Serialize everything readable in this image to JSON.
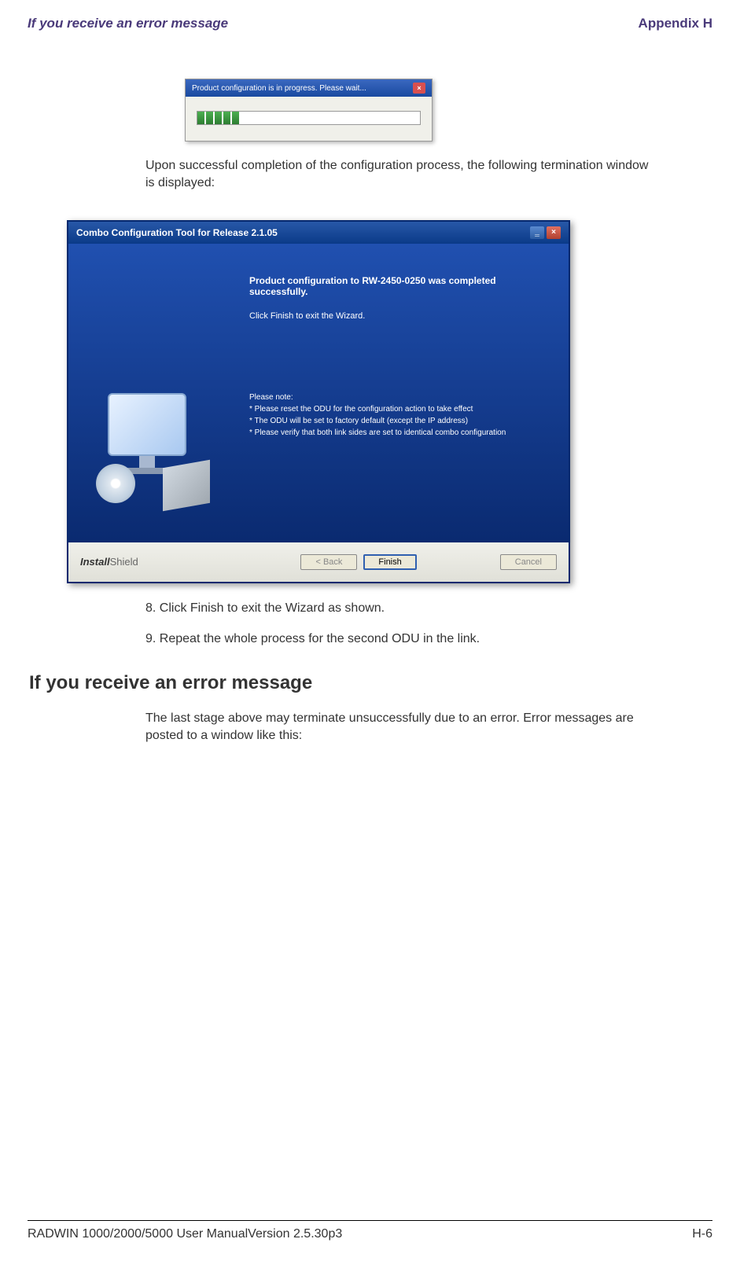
{
  "header": {
    "left": "If you receive an error message",
    "right": "Appendix H"
  },
  "progress_dialog": {
    "title": "Product configuration is in progress. Please wait..."
  },
  "body_after_progress": "Upon successful completion of the configuration process, the following termination window is displayed:",
  "wizard": {
    "title": "Combo Configuration Tool for Release 2.1.05",
    "main_text": "Product configuration to RW-2450-0250  was completed successfully.",
    "sub_text": "Click Finish to exit the Wizard.",
    "note_header": "Please note:",
    "note_line1": "* Please reset the ODU for the configuration action to take effect",
    "note_line2": "* The ODU will be set to factory default (except the IP address)",
    "note_line3": "* Please verify that both link sides are set to identical combo configuration",
    "footer_brand_bold": "Install",
    "footer_brand_light": "Shield",
    "btn_back": "< Back",
    "btn_finish": "Finish",
    "btn_cancel": "Cancel"
  },
  "steps": {
    "step8": "8. Click Finish to exit the Wizard as shown.",
    "step9": "9. Repeat the whole process for the second ODU in the link."
  },
  "section": {
    "heading": "If you receive an error message",
    "body": "The last stage above may terminate unsuccessfully due to an error. Error messages are posted to a window like this:"
  },
  "footer": {
    "left": "RADWIN 1000/2000/5000 User ManualVersion  2.5.30p3",
    "right": "H-6"
  }
}
